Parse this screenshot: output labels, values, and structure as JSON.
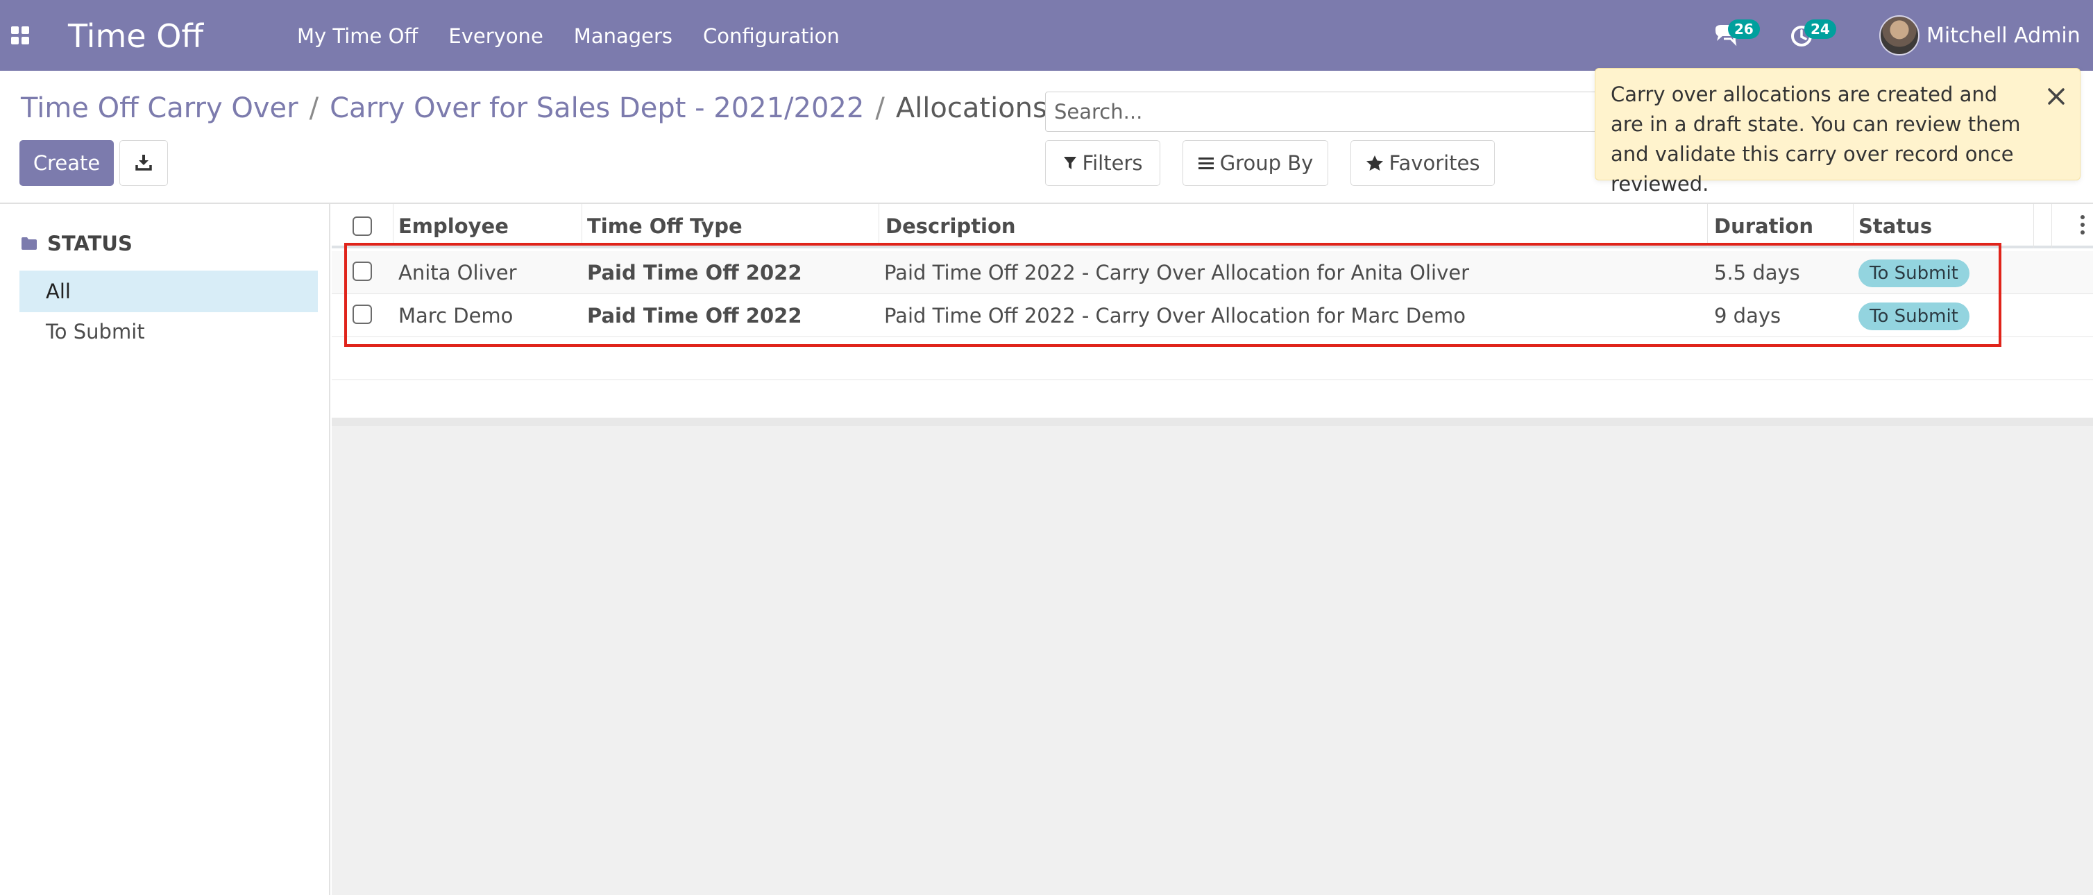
{
  "navbar": {
    "app_title": "Time Off",
    "menu": [
      "My Time Off",
      "Everyone",
      "Managers",
      "Configuration"
    ],
    "chat_count": "26",
    "activity_count": "24",
    "user_name": "Mitchell Admin",
    "background_color": "#7c7bad"
  },
  "breadcrumb": {
    "items": [
      "Time Off Carry Over",
      "Carry Over for Sales Dept - 2021/2022"
    ],
    "current": "Allocations",
    "separator": "/"
  },
  "control_panel": {
    "create_label": "Create",
    "search_placeholder": "Search...",
    "filters_label": "Filters",
    "group_by_label": "Group By",
    "favorites_label": "Favorites"
  },
  "notification": {
    "message": "Carry over allocations are created and are in a draft state. You can review them and validate this carry over record once reviewed."
  },
  "sidebar": {
    "header": "STATUS",
    "items": [
      {
        "label": "All",
        "active": true
      },
      {
        "label": "To Submit",
        "active": false
      }
    ]
  },
  "table": {
    "columns": [
      "Employee",
      "Time Off Type",
      "Description",
      "Duration",
      "Status"
    ],
    "rows": [
      {
        "employee": "Anita Oliver",
        "time_off_type": "Paid Time Off 2022",
        "description": "Paid Time Off 2022 - Carry Over Allocation for Anita Oliver",
        "duration": "5.5 days",
        "status": "To Submit"
      },
      {
        "employee": "Marc Demo",
        "time_off_type": "Paid Time Off 2022",
        "description": "Paid Time Off 2022 - Carry Over Allocation for Marc Demo",
        "duration": "9 days",
        "status": "To Submit"
      }
    ]
  },
  "colors": {
    "accent": "#7c7bad",
    "status_badge": "#93d4df",
    "highlight": "#e0241b",
    "notification_bg": "#fff3cd"
  }
}
